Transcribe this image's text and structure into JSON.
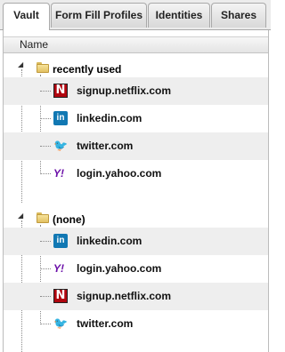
{
  "tabs": [
    {
      "label": "Vault",
      "active": true
    },
    {
      "label": "Form Fill Profiles",
      "active": false
    },
    {
      "label": "Identities",
      "active": false
    },
    {
      "label": "Shares",
      "active": false
    }
  ],
  "list": {
    "column_header": "Name"
  },
  "groups": [
    {
      "name": "recently used",
      "items": [
        {
          "site": "signup.netflix.com",
          "icon": "netflix-icon"
        },
        {
          "site": "linkedin.com",
          "icon": "linkedin-icon"
        },
        {
          "site": "twitter.com",
          "icon": "twitter-icon"
        },
        {
          "site": "login.yahoo.com",
          "icon": "yahoo-icon"
        }
      ]
    },
    {
      "name": "(none)",
      "items": [
        {
          "site": "linkedin.com",
          "icon": "linkedin-icon"
        },
        {
          "site": "login.yahoo.com",
          "icon": "yahoo-icon"
        },
        {
          "site": "signup.netflix.com",
          "icon": "netflix-icon"
        },
        {
          "site": "twitter.com",
          "icon": "twitter-icon"
        }
      ]
    }
  ],
  "icon_glyphs": {
    "netflix": "N",
    "linkedin": "in",
    "yahoo": "Y!",
    "twitter": "🐦"
  },
  "colors": {
    "netflix": "#b1060f",
    "linkedin": "#1178b3",
    "yahoo": "#6b0fa8",
    "twitter": "#2aa3ef",
    "row_shade": "#eeeeee"
  }
}
